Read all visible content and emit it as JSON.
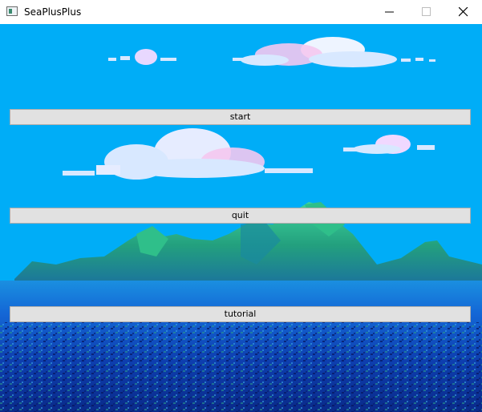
{
  "window": {
    "title": "SeaPlusPlus",
    "icon": "app-icon"
  },
  "controls": {
    "minimize_icon": "minimize-icon",
    "maximize_icon": "maximize-icon",
    "close_icon": "close-icon"
  },
  "menu": {
    "start_label": "start",
    "quit_label": "quit",
    "tutorial_label": "tutorial"
  },
  "colors": {
    "sky": "#00adf7",
    "button_bg": "#e1e1e1",
    "cloud": "#d8e8ff",
    "cloud_pink": "#f4c8f0",
    "island_green": "#2fbf8a",
    "island_dark": "#1a6fa0",
    "sea_dark": "#0b2f9c",
    "sea_mid": "#1467d6"
  }
}
